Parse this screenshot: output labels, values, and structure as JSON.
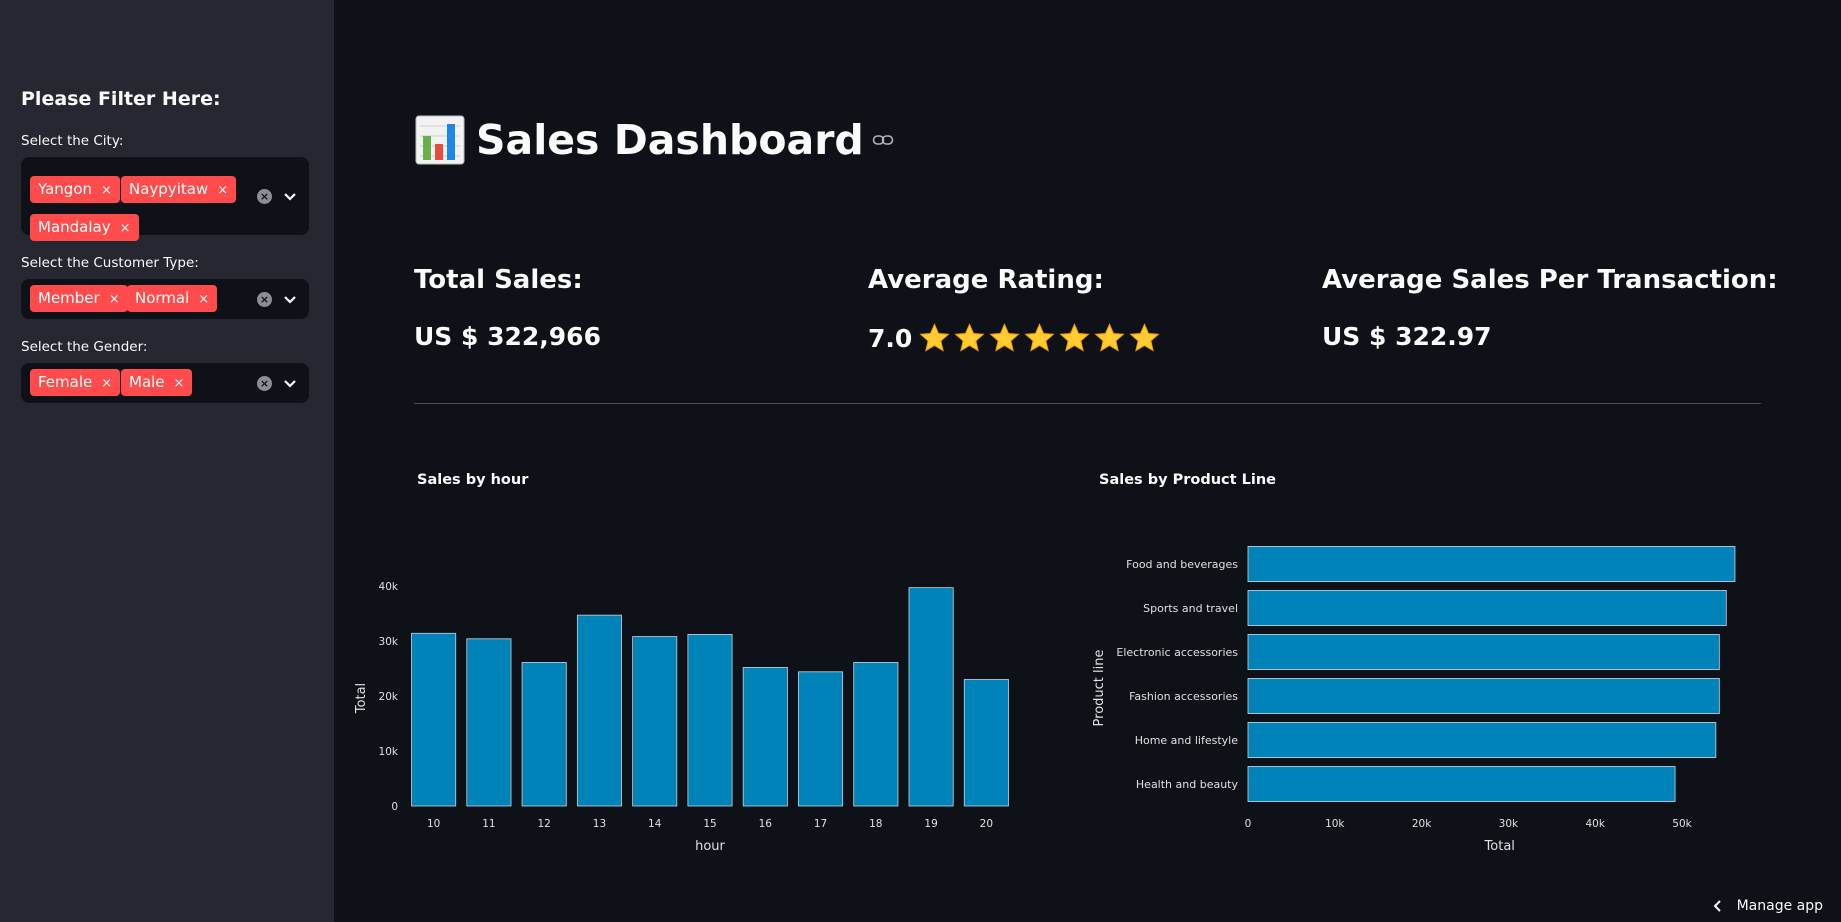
{
  "sidebar": {
    "heading": "Please Filter Here:",
    "filters": [
      {
        "label": "Select the City:",
        "selected": [
          "Yangon",
          "Naypyitaw",
          "Mandalay"
        ]
      },
      {
        "label": "Select the Customer Type:",
        "selected": [
          "Member",
          "Normal"
        ]
      },
      {
        "label": "Select the Gender:",
        "selected": [
          "Female",
          "Male"
        ]
      }
    ],
    "tag_remove_glyph": "×",
    "clear_glyph": "×"
  },
  "header": {
    "title": "Sales Dashboard",
    "emoji_icon": "bar-chart-emoji-icon",
    "link_icon": "link-icon"
  },
  "metrics": [
    {
      "heading": "Total Sales:",
      "value": "US $ 322,966"
    },
    {
      "heading": "Average Rating:",
      "value": "7.0",
      "stars": 7
    },
    {
      "heading": "Average Sales Per Transaction:",
      "value": "US $ 322.97"
    }
  ],
  "colors": {
    "accent": "#ff4b4b",
    "bar": "#0083b8",
    "bg": "#0e1117",
    "sidebar": "#262730"
  },
  "chart_data": [
    {
      "type": "bar",
      "title": "Sales by hour",
      "xlabel": "hour",
      "ylabel": "Total",
      "categories": [
        "10",
        "11",
        "12",
        "13",
        "14",
        "15",
        "16",
        "17",
        "18",
        "19",
        "20"
      ],
      "values": [
        31400,
        30400,
        26100,
        34700,
        30800,
        31200,
        25200,
        24400,
        26100,
        39700,
        23000
      ],
      "ylim": [
        0,
        40000
      ],
      "yticks": [
        0,
        10000,
        20000,
        30000,
        40000
      ],
      "ytick_labels": [
        "0",
        "10k",
        "20k",
        "30k",
        "40k"
      ],
      "grid": false
    },
    {
      "type": "bar",
      "orientation": "horizontal",
      "title": "Sales by Product Line",
      "xlabel": "Total",
      "ylabel": "Product line",
      "categories": [
        "Food and beverages",
        "Sports and travel",
        "Electronic accessories",
        "Fashion accessories",
        "Home and lifestyle",
        "Health and beauty"
      ],
      "values": [
        56100,
        55100,
        54300,
        54300,
        53900,
        49200
      ],
      "xlim": [
        0,
        57000
      ],
      "xticks": [
        0,
        10000,
        20000,
        30000,
        40000,
        50000
      ],
      "xtick_labels": [
        "0",
        "10k",
        "20k",
        "30k",
        "40k",
        "50k"
      ],
      "grid": false
    }
  ],
  "footer": {
    "manage_label": "Manage app"
  }
}
